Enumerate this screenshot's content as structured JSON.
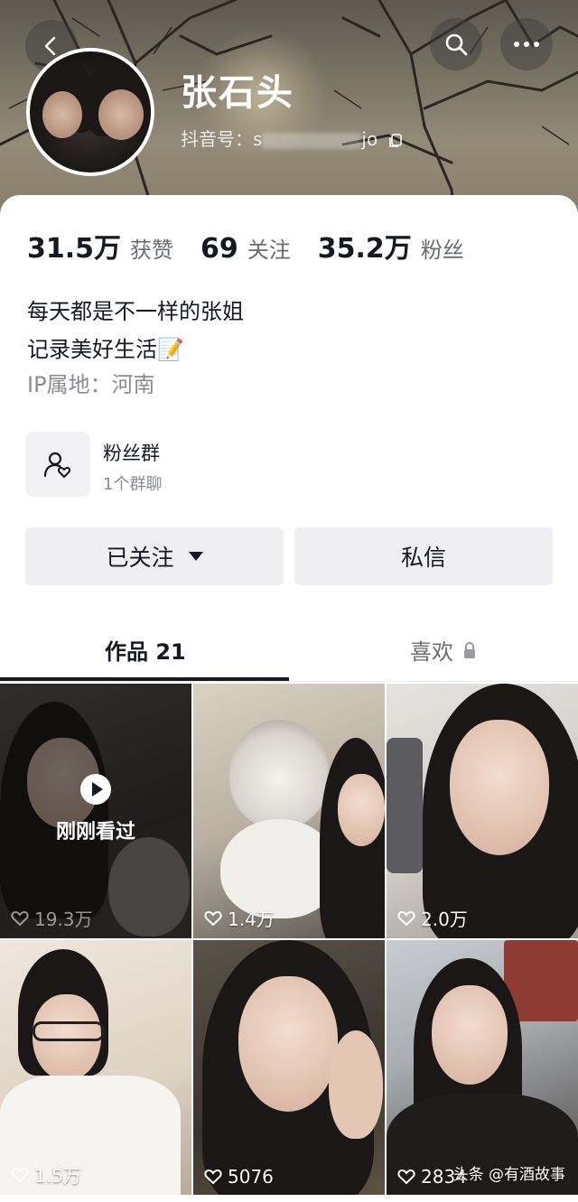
{
  "profile": {
    "name": "张石头",
    "id_prefix": "抖音号：",
    "id_visible_start": "s",
    "id_visible_end": "jo"
  },
  "stats": [
    {
      "value": "31.5万",
      "label": "获赞"
    },
    {
      "value": "69",
      "label": "关注"
    },
    {
      "value": "35.2万",
      "label": "粉丝"
    }
  ],
  "bio": {
    "line1": "每天都是不一样的张姐",
    "line2": "记录美好生活📝",
    "ip": "IP属地：河南"
  },
  "fan_group": {
    "title": "粉丝群",
    "subtitle": "1个群聊"
  },
  "actions": {
    "follow_label": "已关注",
    "message_label": "私信"
  },
  "tabs": {
    "works": "作品 21",
    "likes": "喜欢"
  },
  "videos": [
    {
      "likes": "19.3万",
      "overlay": "刚刚看过"
    },
    {
      "likes": "1.4万"
    },
    {
      "likes": "2.0万"
    },
    {
      "likes": "1.5万"
    },
    {
      "likes": "5076"
    },
    {
      "likes": "2834"
    }
  ],
  "watermark": "头条 @有酒故事",
  "icons": {
    "back": "back-arrow-icon",
    "search": "search-icon",
    "more": "more-dots-icon",
    "copy": "copy-icon",
    "group": "fan-group-icon",
    "lock": "lock-icon",
    "heart": "heart-icon",
    "play": "play-icon"
  }
}
